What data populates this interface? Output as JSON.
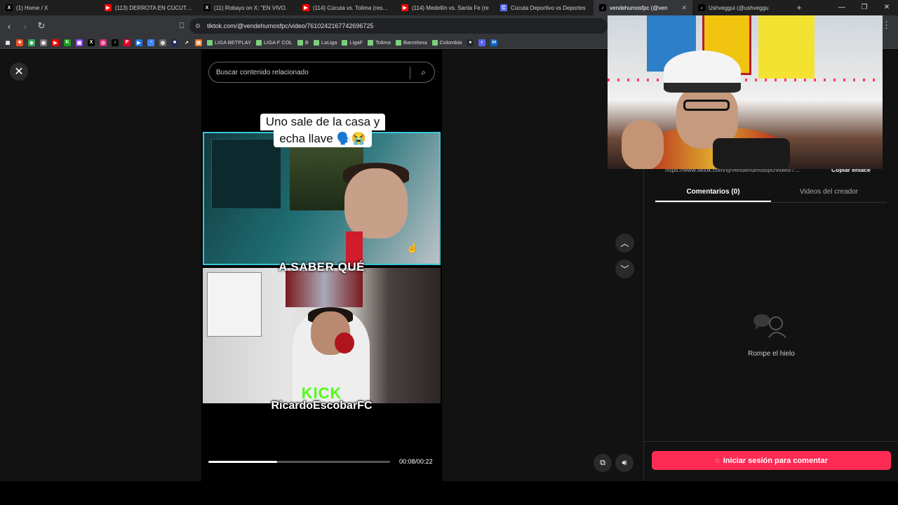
{
  "browser": {
    "tabs": [
      {
        "title": "(1) Home / X",
        "icon": "x-logo-icon",
        "color": "#000000",
        "glyph": "X"
      },
      {
        "title": "(113) DERROTA EN CÚCUTA - ",
        "icon": "youtube-icon",
        "color": "#ff0000",
        "glyph": "▶"
      },
      {
        "title": "(11) Robayo on X: \"EN VIVO. ",
        "icon": "x-logo-icon",
        "color": "#000000",
        "glyph": "X"
      },
      {
        "title": "(114) Cúcuta vs. Tolima (resum",
        "icon": "youtube-icon",
        "color": "#ff0000",
        "glyph": "▶"
      },
      {
        "title": "(114) Medellín vs. Santa Fe (re",
        "icon": "youtube-icon",
        "color": "#ff0000",
        "glyph": "▶"
      },
      {
        "title": "Cúcuta Deportivo vs Deportes",
        "icon": "page-icon",
        "color": "#5b6ef5",
        "glyph": "C"
      },
      {
        "title": "vendehumosfpc (@ven",
        "icon": "tiktok-icon",
        "color": "#000000",
        "glyph": "♪",
        "active": true
      },
      {
        "title": "Ushveggui (@ushveggu",
        "icon": "tiktok-icon",
        "color": "#000000",
        "glyph": "♪"
      }
    ],
    "new_tab": "+",
    "url": "tiktok.com/@vendehumosfpc/video/7610242167742696725",
    "bookmarks": [
      {
        "label": "",
        "icon": "apps-grid-icon",
        "glyph": "▦",
        "color": "#35363a"
      },
      {
        "label": "",
        "icon": "microsoft-icon",
        "glyph": "■",
        "color": "#f25022"
      },
      {
        "label": "",
        "icon": "maps-icon",
        "glyph": "◆",
        "color": "#34a853"
      },
      {
        "label": "",
        "icon": "chrome-icon",
        "glyph": "◉",
        "color": "#777777"
      },
      {
        "label": "",
        "icon": "youtube-icon",
        "glyph": "▶",
        "color": "#ff0000"
      },
      {
        "label": "",
        "icon": "kick-icon",
        "glyph": "K",
        "color": "#1a9e1a"
      },
      {
        "label": "",
        "icon": "twitch-icon",
        "glyph": "▣",
        "color": "#9146ff"
      },
      {
        "label": "",
        "icon": "x-logo-icon",
        "glyph": "X",
        "color": "#000000"
      },
      {
        "label": "",
        "icon": "instagram-icon",
        "glyph": "◎",
        "color": "#d62976"
      },
      {
        "label": "",
        "icon": "tiktok-icon",
        "glyph": "♪",
        "color": "#000000"
      },
      {
        "label": "",
        "icon": "pinterest-icon",
        "glyph": "P",
        "color": "#e60023"
      },
      {
        "label": "",
        "icon": "blue-app-icon",
        "glyph": "▶",
        "color": "#1a73e8"
      },
      {
        "label": "",
        "icon": "pie-icon",
        "glyph": "◔",
        "color": "#4285f4"
      },
      {
        "label": "",
        "icon": "globe-icon",
        "glyph": "◍",
        "color": "#666666"
      },
      {
        "label": "",
        "icon": "dark-app-icon",
        "glyph": "■",
        "color": "#1e2a5a"
      },
      {
        "label": "",
        "icon": "arrow-icon",
        "glyph": "↗",
        "color": "#333333"
      },
      {
        "label": "",
        "icon": "shop-icon",
        "glyph": "▤",
        "color": "#e8711a"
      }
    ],
    "folders": [
      "LIGA BETPLAY",
      "LIGA F COL",
      "B",
      "LaLiga",
      "LigaF",
      "Tolima",
      "Barcelona",
      "Colombia"
    ],
    "bookmarks_tail": [
      {
        "icon": "github-icon",
        "glyph": "●",
        "color": "#24292e"
      },
      {
        "icon": "discord-icon",
        "glyph": "◐",
        "color": "#5865f2"
      },
      {
        "icon": "linkedin-icon",
        "glyph": "in",
        "color": "#0a66c2"
      }
    ]
  },
  "search": {
    "placeholder": "Buscar contenido relacionado"
  },
  "video": {
    "caption_line1": "Uno sale de la casa y",
    "caption_line2": "echa llave 🗣️😭",
    "overlay_text": "A SABER QUÉ",
    "kick_logo": "KICK",
    "channel_name": "RicardoEscobarFC",
    "time_current": "00:08",
    "time_total": "00:22",
    "progress": 0.38
  },
  "side": {
    "share_link": "https://www.tiktok.com/@vendehumosfpc/video/7...",
    "copy_link_label": "Copiar enlace",
    "tabs": [
      "Comentarios (0)",
      "Videos del creador"
    ],
    "empty_text": "Rompe el hielo",
    "login_label": "Iniciar sesión para comentar"
  },
  "colors": {
    "accent": "#fe2c55",
    "kick": "#53fc18",
    "frame_border": "#3ac6d8"
  }
}
